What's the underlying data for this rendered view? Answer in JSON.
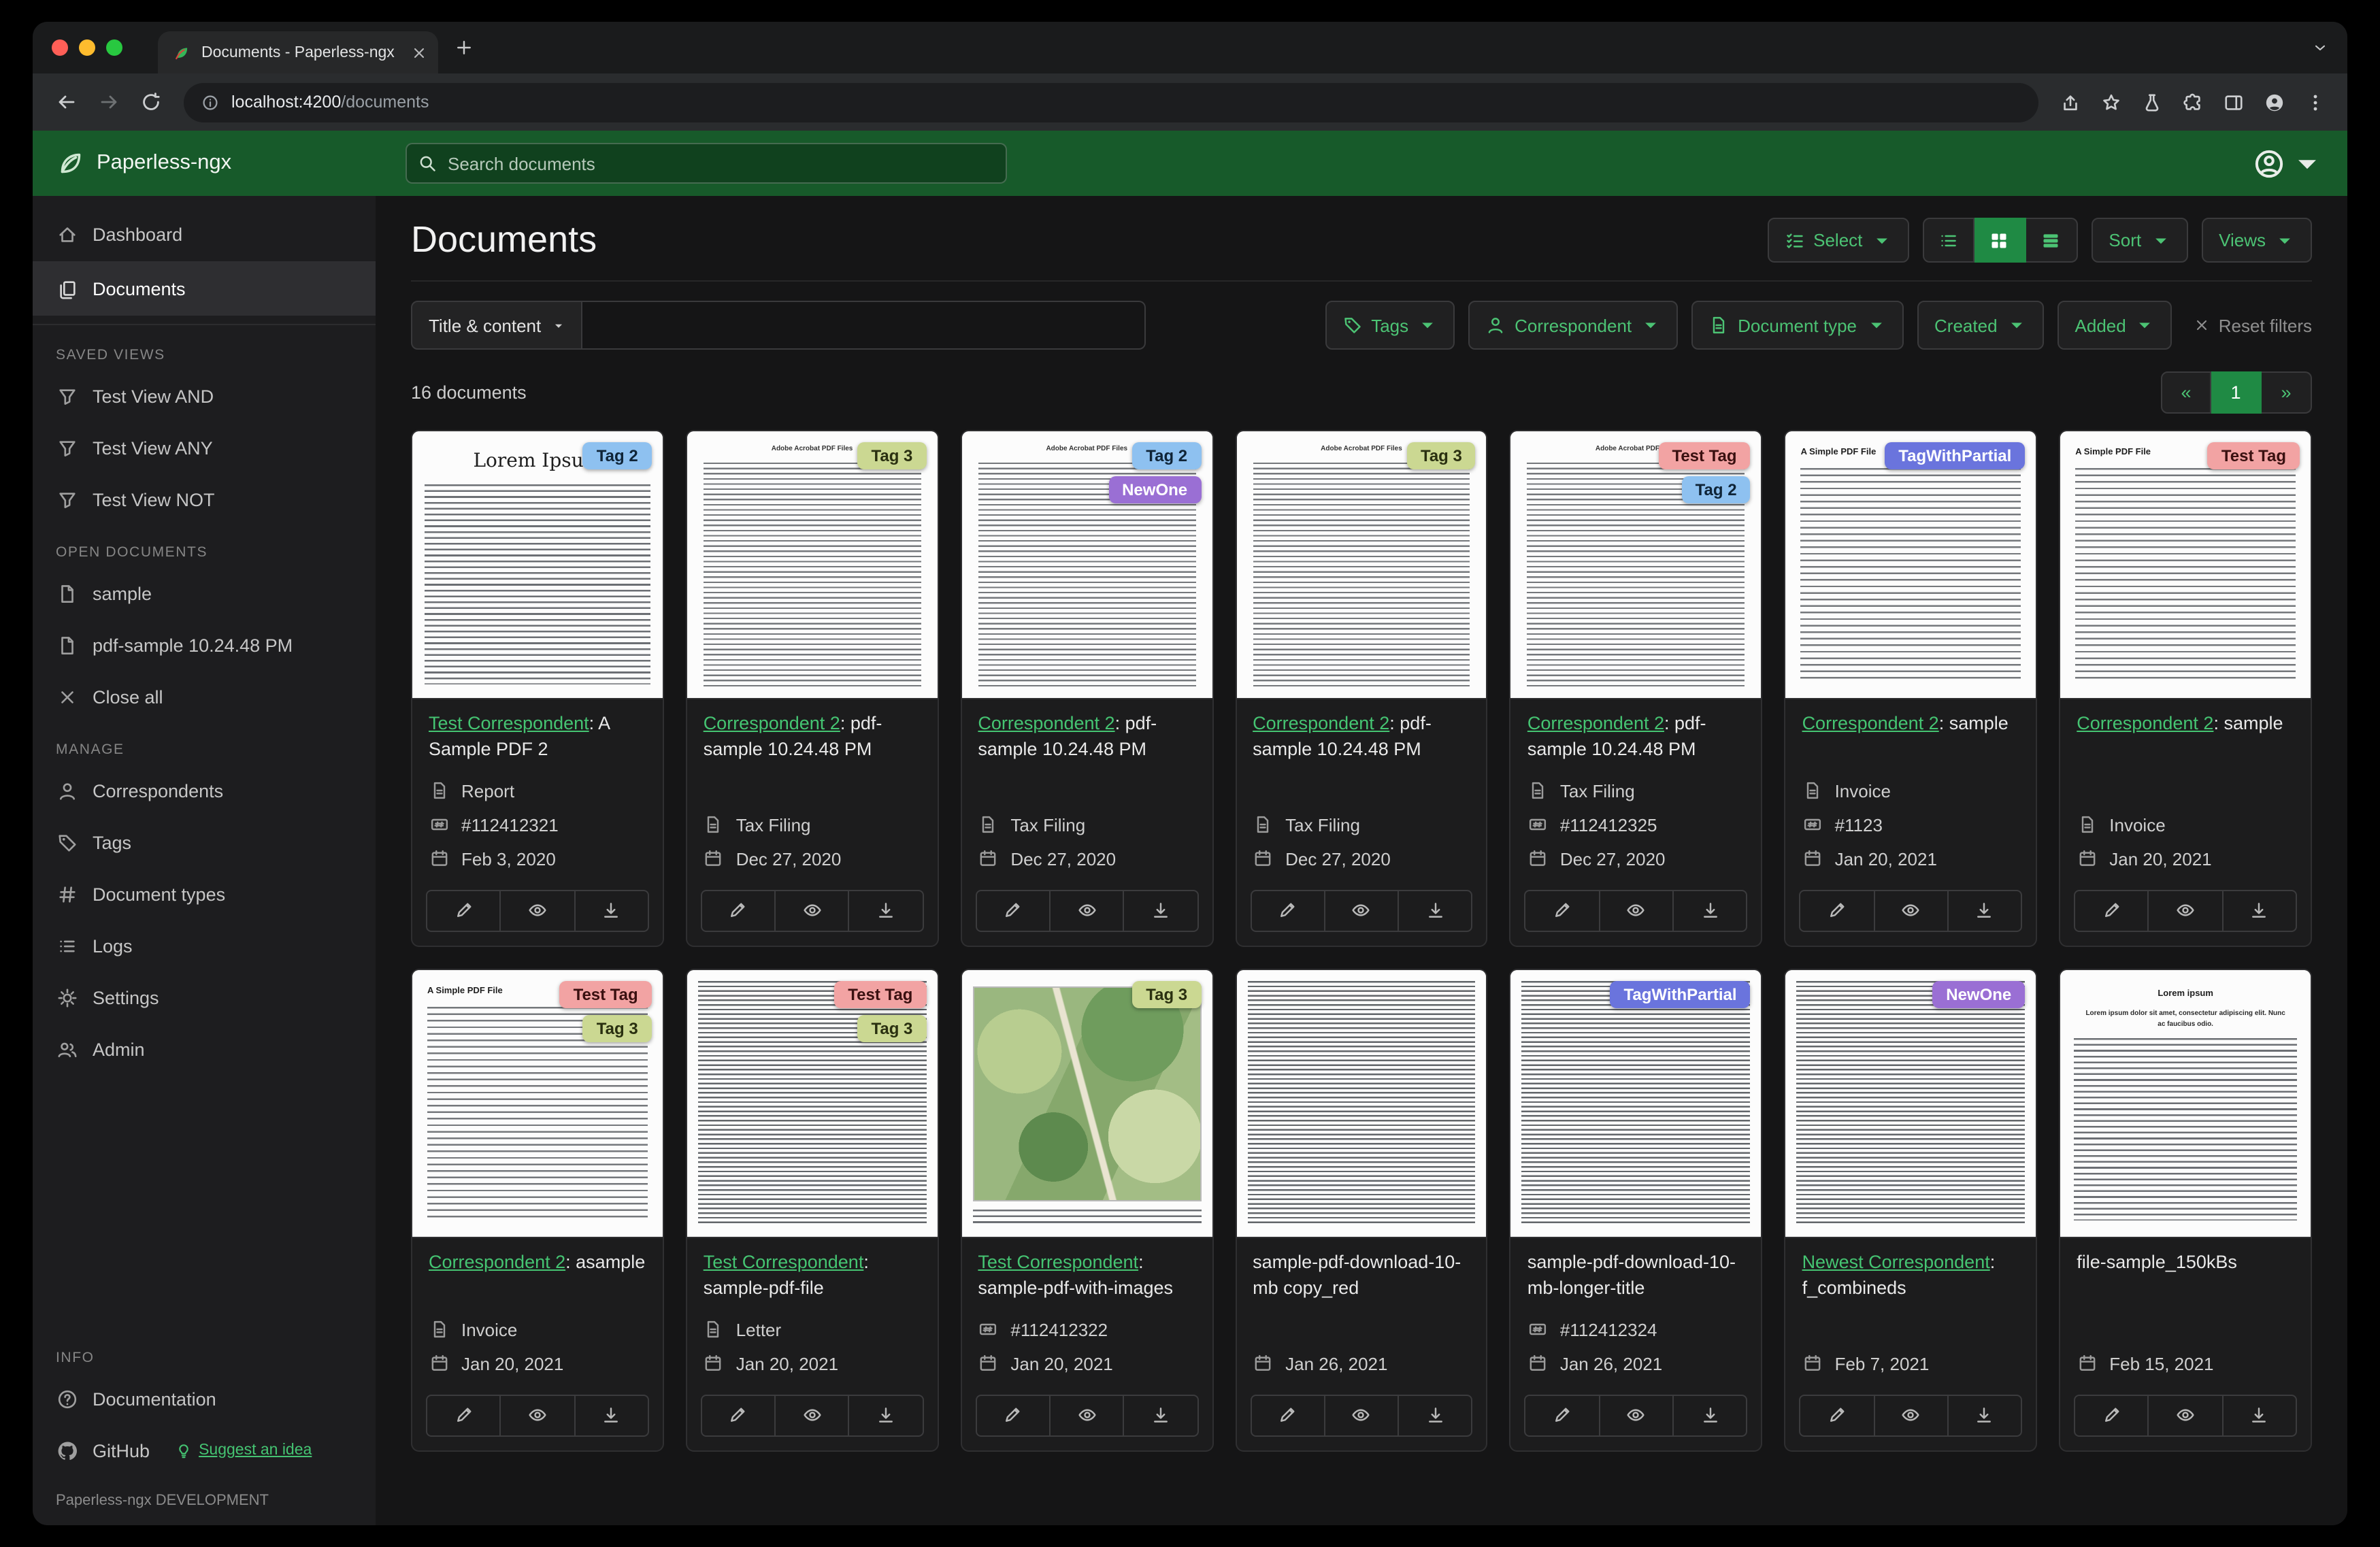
{
  "colors": {
    "accent": "#1f8a44",
    "hdr": "#175a2a",
    "link": "#45c472",
    "greentext": "#4cc374",
    "tab_red": "#ff5f57",
    "tab_yellow": "#febc2e",
    "tab_green": "#28c840"
  },
  "browser": {
    "tab_title": "Documents - Paperless-ngx",
    "url_host": "localhost:4200",
    "url_path": "/documents"
  },
  "header": {
    "brand": "Paperless-ngx",
    "search_placeholder": "Search documents"
  },
  "sidebar": {
    "nav": [
      {
        "icon": "home",
        "label": "Dashboard"
      },
      {
        "icon": "documents",
        "label": "Documents"
      }
    ],
    "sections": [
      {
        "title": "SAVED VIEWS",
        "items": [
          {
            "icon": "funnel",
            "label": "Test View AND"
          },
          {
            "icon": "funnel",
            "label": "Test View ANY"
          },
          {
            "icon": "funnel",
            "label": "Test View NOT"
          }
        ]
      },
      {
        "title": "OPEN DOCUMENTS",
        "items": [
          {
            "icon": "file",
            "label": "sample"
          },
          {
            "icon": "file",
            "label": "pdf-sample 10.24.48 PM"
          },
          {
            "icon": "close",
            "label": "Close all"
          }
        ]
      },
      {
        "title": "MANAGE",
        "items": [
          {
            "icon": "person",
            "label": "Correspondents"
          },
          {
            "icon": "tag",
            "label": "Tags"
          },
          {
            "icon": "hash",
            "label": "Document types"
          },
          {
            "icon": "list",
            "label": "Logs"
          },
          {
            "icon": "gear",
            "label": "Settings"
          },
          {
            "icon": "users",
            "label": "Admin"
          }
        ]
      },
      {
        "title": "INFO",
        "items": [
          {
            "icon": "question",
            "label": "Documentation"
          },
          {
            "icon": "github",
            "label": "GitHub"
          }
        ],
        "extra": {
          "icon": "bulb",
          "label": "Suggest an idea"
        }
      }
    ],
    "footer": "Paperless-ngx DEVELOPMENT"
  },
  "main": {
    "title": "Documents",
    "select_label": "Select",
    "sort_label": "Sort",
    "views_label": "Views",
    "filters": {
      "title_content_label": "Title & content",
      "buttons": [
        {
          "icon": "tag",
          "label": "Tags"
        },
        {
          "icon": "person",
          "label": "Correspondent"
        },
        {
          "icon": "doctype",
          "label": "Document type"
        },
        {
          "icon": "",
          "label": "Created"
        },
        {
          "icon": "",
          "label": "Added"
        }
      ],
      "reset_label": "Reset filters"
    },
    "count_text": "16 documents",
    "pagination": {
      "prev": "«",
      "page": "1",
      "next": "»"
    }
  },
  "tag_styles": {
    "Tag 2": {
      "bg": "#8ec1f0",
      "fg": "#0f2437"
    },
    "Tag 3": {
      "bg": "#cbd892",
      "fg": "#2a3010"
    },
    "NewOne": {
      "bg": "#9a6fd4",
      "fg": "#ffffff"
    },
    "Test Tag": {
      "bg": "#f2a3a3",
      "fg": "#3a1010"
    },
    "TagWithPartial": {
      "bg": "#6a74dd",
      "fg": "#ffffff"
    }
  },
  "cards": [
    {
      "thumb": {
        "variant": "lorem",
        "heading": "Lorem Ipsum"
      },
      "tags": [
        "Tag 2"
      ],
      "link": "Test Correspondent",
      "title_rest": ": A Sample PDF 2",
      "meta": [
        {
          "icon": "doc",
          "text": "Report"
        },
        {
          "icon": "id",
          "text": "#112412321"
        },
        {
          "icon": "cal",
          "text": "Feb 3, 2020"
        }
      ]
    },
    {
      "thumb": {
        "variant": "acrobat",
        "heading": "Adobe Acrobat PDF Files"
      },
      "tags": [
        "Tag 3"
      ],
      "link": "Correspondent 2",
      "title_rest": ": pdf-sample 10.24.48 PM",
      "meta": [
        {
          "icon": "doc",
          "text": "Tax Filing"
        },
        {
          "icon": "cal",
          "text": "Dec 27, 2020"
        }
      ]
    },
    {
      "thumb": {
        "variant": "acrobat",
        "heading": "Adobe Acrobat PDF Files"
      },
      "tags": [
        "Tag 2",
        "NewOne"
      ],
      "link": "Correspondent 2",
      "title_rest": ": pdf-sample 10.24.48 PM",
      "meta": [
        {
          "icon": "doc",
          "text": "Tax Filing"
        },
        {
          "icon": "cal",
          "text": "Dec 27, 2020"
        }
      ]
    },
    {
      "thumb": {
        "variant": "acrobat",
        "heading": "Adobe Acrobat PDF Files"
      },
      "tags": [
        "Tag 3"
      ],
      "link": "Correspondent 2",
      "title_rest": ": pdf-sample 10.24.48 PM",
      "meta": [
        {
          "icon": "doc",
          "text": "Tax Filing"
        },
        {
          "icon": "cal",
          "text": "Dec 27, 2020"
        }
      ]
    },
    {
      "thumb": {
        "variant": "acrobat",
        "heading": "Adobe Acrobat PDF Files"
      },
      "tags": [
        "Test Tag",
        "Tag 2"
      ],
      "link": "Correspondent 2",
      "title_rest": ": pdf-sample 10.24.48 PM",
      "meta": [
        {
          "icon": "doc",
          "text": "Tax Filing"
        },
        {
          "icon": "id",
          "text": "#112412325"
        },
        {
          "icon": "cal",
          "text": "Dec 27, 2020"
        }
      ]
    },
    {
      "thumb": {
        "variant": "simple",
        "heading": "A Simple PDF File"
      },
      "tags": [
        "TagWithPartial"
      ],
      "link": "Correspondent 2",
      "title_rest": ": sample",
      "meta": [
        {
          "icon": "doc",
          "text": "Invoice"
        },
        {
          "icon": "id",
          "text": "#1123"
        },
        {
          "icon": "cal",
          "text": "Jan 20, 2021"
        }
      ]
    },
    {
      "thumb": {
        "variant": "simple",
        "heading": "A Simple PDF File"
      },
      "tags": [
        "Test Tag"
      ],
      "link": "Correspondent 2",
      "title_rest": ": sample",
      "meta": [
        {
          "icon": "doc",
          "text": "Invoice"
        },
        {
          "icon": "cal",
          "text": "Jan 20, 2021"
        }
      ]
    },
    {
      "thumb": {
        "variant": "simple",
        "heading": "A Simple PDF File"
      },
      "tags": [
        "Test Tag",
        "Tag 3"
      ],
      "link": "Correspondent 2",
      "title_rest": ": asample",
      "meta": [
        {
          "icon": "doc",
          "text": "Invoice"
        },
        {
          "icon": "cal",
          "text": "Jan 20, 2021"
        }
      ]
    },
    {
      "thumb": {
        "variant": "dense",
        "heading": ""
      },
      "tags": [
        "Test Tag",
        "Tag 3"
      ],
      "link": "Test Correspondent",
      "title_rest": ": sample-pdf-file",
      "meta": [
        {
          "icon": "doc",
          "text": "Letter"
        },
        {
          "icon": "cal",
          "text": "Jan 20, 2021"
        }
      ]
    },
    {
      "thumb": {
        "variant": "map",
        "heading": ""
      },
      "tags": [
        "Tag 3"
      ],
      "link": "Test Correspondent",
      "title_rest": ": sample-pdf-with-images",
      "meta": [
        {
          "icon": "id",
          "text": "#112412322"
        },
        {
          "icon": "cal",
          "text": "Jan 20, 2021"
        }
      ]
    },
    {
      "thumb": {
        "variant": "dense",
        "heading": ""
      },
      "tags": [],
      "plain_title": "sample-pdf-download-10-mb copy_red",
      "meta": [
        {
          "icon": "cal",
          "text": "Jan 26, 2021"
        }
      ]
    },
    {
      "thumb": {
        "variant": "dense",
        "heading": ""
      },
      "tags": [
        "TagWithPartial"
      ],
      "plain_title": "sample-pdf-download-10-mb-longer-title",
      "meta": [
        {
          "icon": "id",
          "text": "#112412324"
        },
        {
          "icon": "cal",
          "text": "Jan 26, 2021"
        }
      ]
    },
    {
      "thumb": {
        "variant": "dense",
        "heading": ""
      },
      "tags": [
        "NewOne"
      ],
      "link": "Newest Correspondent",
      "title_rest": ": f_combineds",
      "meta": [
        {
          "icon": "cal",
          "text": "Feb 7, 2021"
        }
      ]
    },
    {
      "thumb": {
        "variant": "lorem2",
        "heading": "Lorem ipsum",
        "para": "Lorem ipsum dolor sit amet, consectetur adipiscing elit. Nunc ac faucibus odio."
      },
      "tags": [],
      "plain_title": "file-sample_150kBs",
      "meta": [
        {
          "icon": "cal",
          "text": "Feb 15, 2021"
        }
      ]
    }
  ]
}
